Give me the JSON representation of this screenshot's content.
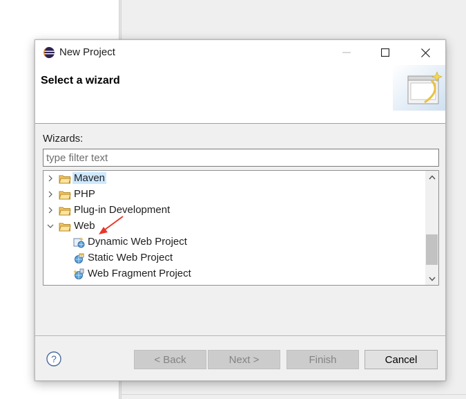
{
  "dialog": {
    "title": "New Project",
    "header_title": "Select a wizard"
  },
  "wizards": {
    "label": "Wizards:",
    "filter_placeholder": "type filter text",
    "filter_value": ""
  },
  "tree": {
    "items": [
      {
        "label": "Maven",
        "type": "folder",
        "expanded": false,
        "selected": true
      },
      {
        "label": "PHP",
        "type": "folder",
        "expanded": false
      },
      {
        "label": "Plug-in Development",
        "type": "folder",
        "expanded": false
      },
      {
        "label": "Web",
        "type": "folder",
        "expanded": true
      },
      {
        "label": "Dynamic Web Project",
        "type": "wizard"
      },
      {
        "label": "Static Web Project",
        "type": "wizard"
      },
      {
        "label": "Web Fragment Project",
        "type": "wizard"
      }
    ]
  },
  "buttons": {
    "back": "< Back",
    "next": "Next >",
    "finish": "Finish",
    "cancel": "Cancel"
  },
  "icons": {
    "app": "eclipse-icon",
    "help": "help-icon",
    "minimize": "minimize-icon",
    "maximize": "maximize-icon",
    "close": "close-icon"
  },
  "colors": {
    "selection": "#cde8ff",
    "annotation_arrow": "#e8362a",
    "folder": "#e2b24c"
  }
}
